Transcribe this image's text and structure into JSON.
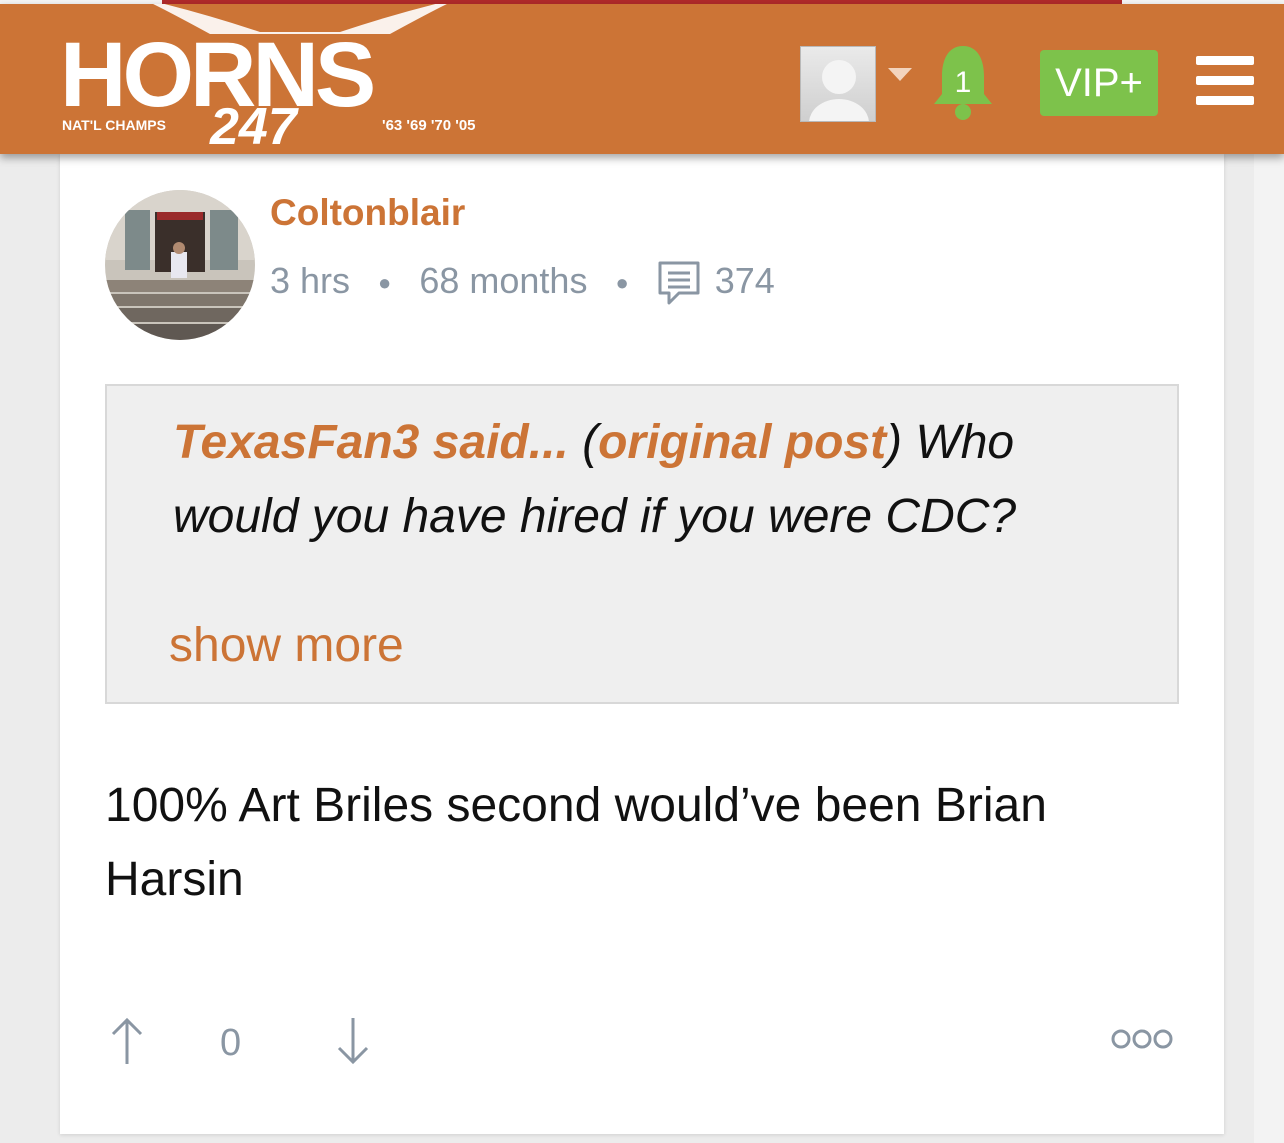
{
  "header": {
    "logo_word": "HORNS",
    "logo_number": "247",
    "logo_left_text": "NAT'L CHAMPS",
    "logo_years": "'63 '69 '70 '05",
    "notification_count": "1",
    "vip_label": "VIP+",
    "colors": {
      "bar": "#cc7436",
      "vip": "#7dc24b",
      "bell": "#7dc24b"
    }
  },
  "post": {
    "username": "Coltonblair",
    "time_ago": "3 hrs",
    "membership": "68 months",
    "post_count": "374",
    "quote": {
      "author": "TexasFan3 said...",
      "open_paren": " (",
      "link_label": "original post",
      "close_text": ") Who would you have hired if you were CDC?",
      "show_more": "show more"
    },
    "body": "100% Art Briles second would’ve been Brian Harsin",
    "votes": "0"
  }
}
